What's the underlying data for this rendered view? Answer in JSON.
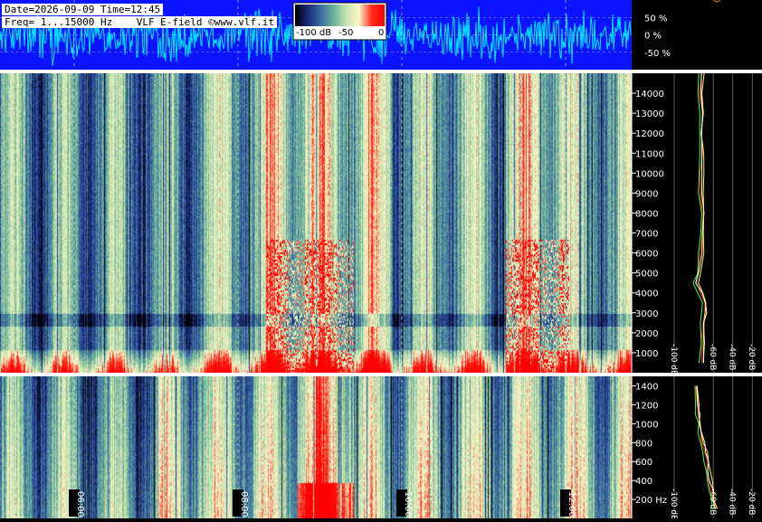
{
  "header": {
    "datetime": "Date=2026-09-09 Time=12:45",
    "freq_line": "Freq= 1...15000 Hz    VLF E-field ©www.vlf.it"
  },
  "colorbar": {
    "labels": [
      "-100 dB",
      "-50",
      "0"
    ],
    "stops": [
      "#000000",
      "#1a2a7a",
      "#3a6aa0",
      "#6ab09a",
      "#c8e2b0",
      "#fbf6c8",
      "#ff2a1a",
      "#ff0000"
    ]
  },
  "colors": {
    "waveform_bg": "#0a14ff",
    "waveform_trace": "#00e5ff",
    "marker": "#d98a00",
    "spectrum_lines": [
      "#ff2020",
      "#ffff40",
      "#40ff40",
      "#ffffff"
    ]
  },
  "chart_data": [
    {
      "type": "line",
      "name": "waveform",
      "ytick_labels": [
        "50 %",
        "0 %",
        "-50 %"
      ],
      "yticks": [
        50,
        0,
        -50
      ],
      "ylim": [
        -100,
        100
      ]
    },
    {
      "type": "heatmap",
      "name": "spectrogram-wideband",
      "y_unit": "Hz",
      "ylim": [
        0,
        15000
      ],
      "yticks": [
        1000,
        2000,
        3000,
        4000,
        5000,
        6000,
        7000,
        8000,
        9000,
        10000,
        11000,
        12000,
        13000,
        14000
      ],
      "ytick_labels": [
        "1000",
        "2000",
        "3000",
        "4000",
        "5000",
        "6000",
        "7000",
        "8000",
        "9000",
        "10000",
        "11000",
        "12000",
        "13000",
        "14000"
      ],
      "xtick_labels": [
        "06:00",
        "08:00",
        "10:00",
        "12:00"
      ],
      "hot_regions": [
        [
          0.42,
          0.56
        ],
        [
          0.58,
          0.62
        ],
        [
          0.8,
          0.9
        ]
      ]
    },
    {
      "type": "heatmap",
      "name": "spectrogram-lowband",
      "y_unit": "Hz",
      "ylim": [
        0,
        1500
      ],
      "yticks": [
        200,
        400,
        600,
        800,
        1000,
        1200,
        1400
      ],
      "ytick_labels": [
        "200 Hz",
        "400",
        "600",
        "800",
        "1000",
        "1200",
        "1400"
      ]
    },
    {
      "type": "line",
      "name": "spectrum-wideband",
      "xtick_labels": [
        "-100 dB",
        "-60 dB",
        "-40 dB",
        "-20 dB"
      ],
      "xticks": [
        -100,
        -60,
        -40,
        -20
      ],
      "xlim": [
        -100,
        -10
      ],
      "ylim": [
        0,
        15000
      ],
      "x": [
        -72,
        -71,
        -70,
        -69,
        -70,
        -73,
        -78,
        -75,
        -72,
        -72,
        -71,
        -72,
        -73,
        -72,
        -73,
        -72,
        -73,
        -72
      ],
      "y": [
        500,
        1500,
        2500,
        3000,
        3500,
        4000,
        4500,
        5000,
        6000,
        7000,
        8000,
        9000,
        10000,
        11000,
        12000,
        13000,
        14000,
        15000
      ]
    },
    {
      "type": "line",
      "name": "spectrum-lowband",
      "xtick_labels": [
        "-100 dB",
        "-60 dB",
        "-40 dB",
        "-20 dB"
      ],
      "xticks": [
        -100,
        -60,
        -40,
        -20
      ],
      "xlim": [
        -100,
        -10
      ],
      "ylim": [
        0,
        1500
      ],
      "x": [
        -58,
        -60,
        -62,
        -64,
        -66,
        -67,
        -69,
        -71,
        -73,
        -74,
        -76,
        -77,
        -78
      ],
      "y": [
        100,
        200,
        300,
        400,
        500,
        600,
        700,
        800,
        900,
        1000,
        1100,
        1200,
        1400
      ]
    }
  ]
}
